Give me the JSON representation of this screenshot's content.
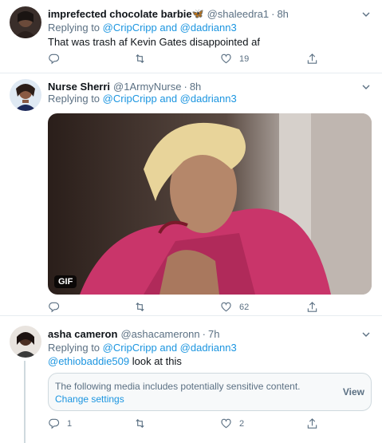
{
  "tweets": [
    {
      "name": "imprefected chocolate barbie",
      "name_emoji": "🦋",
      "handle": "@shaleedra1",
      "time": "8h",
      "replying_prefix": "Replying to ",
      "replying_to": "@CripCripp and @dadriann3",
      "text": "That was trash af Kevin Gates disappointed af",
      "likes": "19"
    },
    {
      "name": "Nurse Sherri",
      "handle": "@1ArmyNurse",
      "time": "8h",
      "replying_prefix": "Replying to ",
      "replying_to": "@CripCripp and @dadriann3",
      "gif_label": "GIF",
      "likes": "62"
    },
    {
      "name": "asha cameron",
      "handle": "@ashacameronn",
      "time": "7h",
      "replying_prefix": "Replying to ",
      "replying_to": "@CripCripp and @dadriann3",
      "mention": "@ethiobaddie509",
      "text_rest": " look at this",
      "sensitive_notice": "The following media includes potentially sensitive content.",
      "change_settings": "Change settings",
      "view_label": "View",
      "replies": "1",
      "likes": "2"
    }
  ],
  "icons": {
    "reply": "reply-icon",
    "retweet": "retweet-icon",
    "like": "heart-icon",
    "share": "share-icon",
    "caret": "chevron-down-icon"
  },
  "colors": {
    "link": "#1b95e0",
    "secondary_text": "#5b7083",
    "border": "#e6ecf0"
  }
}
